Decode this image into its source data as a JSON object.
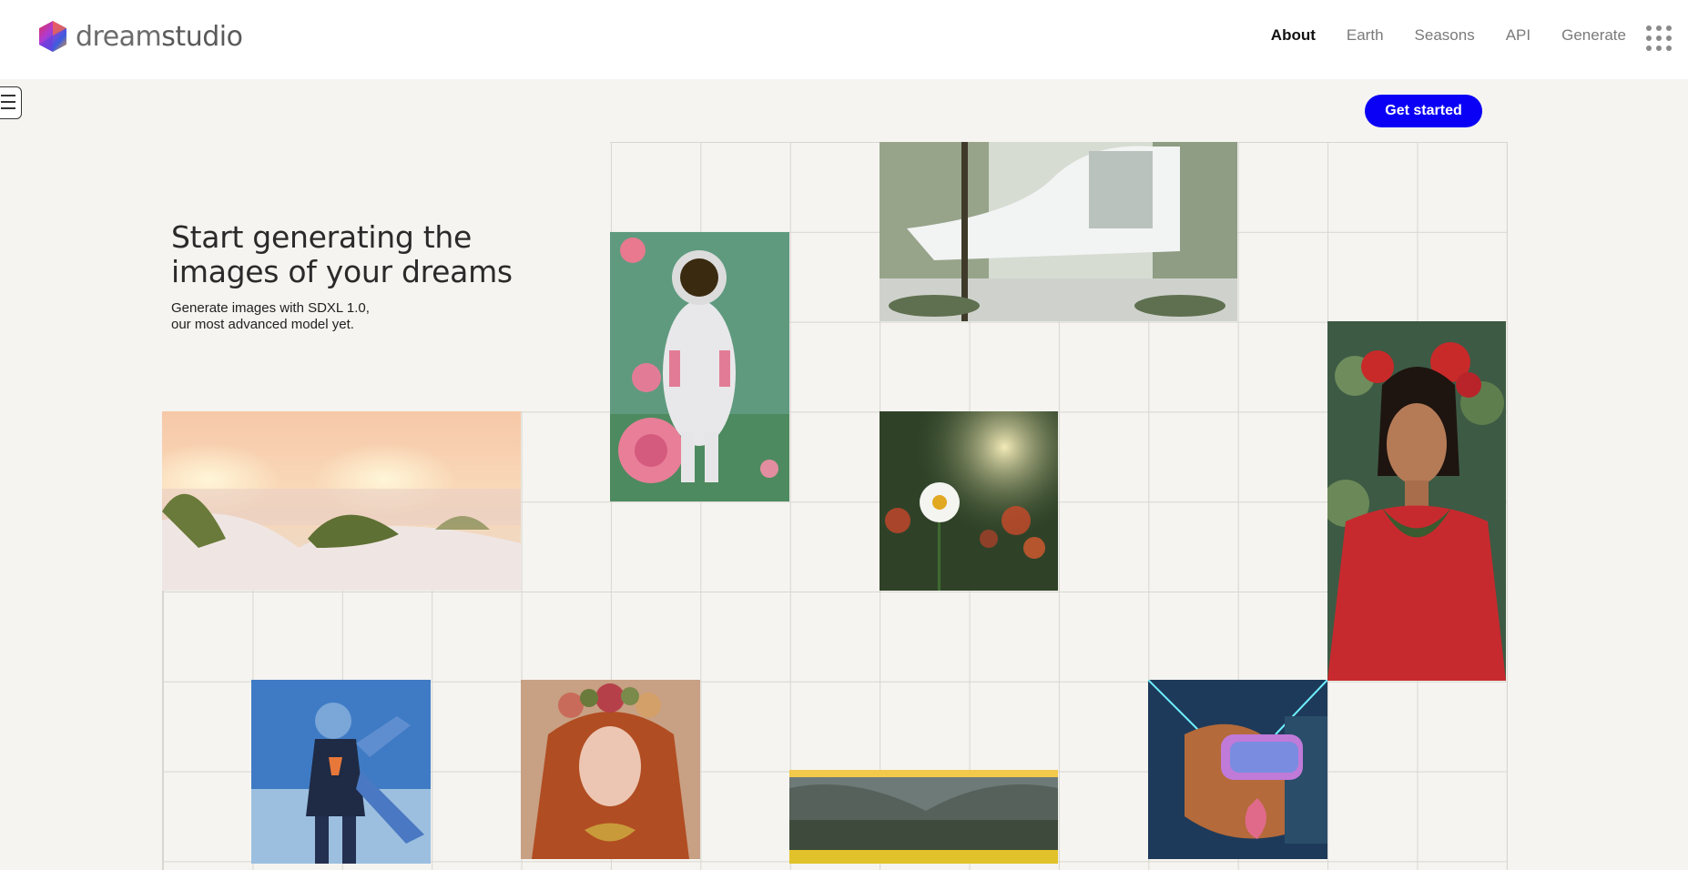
{
  "brand": {
    "name_light": "dream",
    "name_bold": "studio"
  },
  "nav": {
    "items": [
      "About",
      "Earth",
      "Seasons",
      "API",
      "Generate"
    ],
    "active": "About"
  },
  "cta": {
    "label": "Get started"
  },
  "hero": {
    "title_line1": "Start generating the",
    "title_line2": "images of your dreams",
    "sub_line1": "Generate images with SDXL 1.0,",
    "sub_line2": "our most advanced model yet."
  },
  "colors": {
    "accent": "#0a00f5",
    "background": "#f5f4f0",
    "grid_line": "#d8d6d0"
  },
  "icons": [
    "logo-hexagon-icon",
    "apps-grid-icon",
    "hamburger-menu-icon"
  ]
}
